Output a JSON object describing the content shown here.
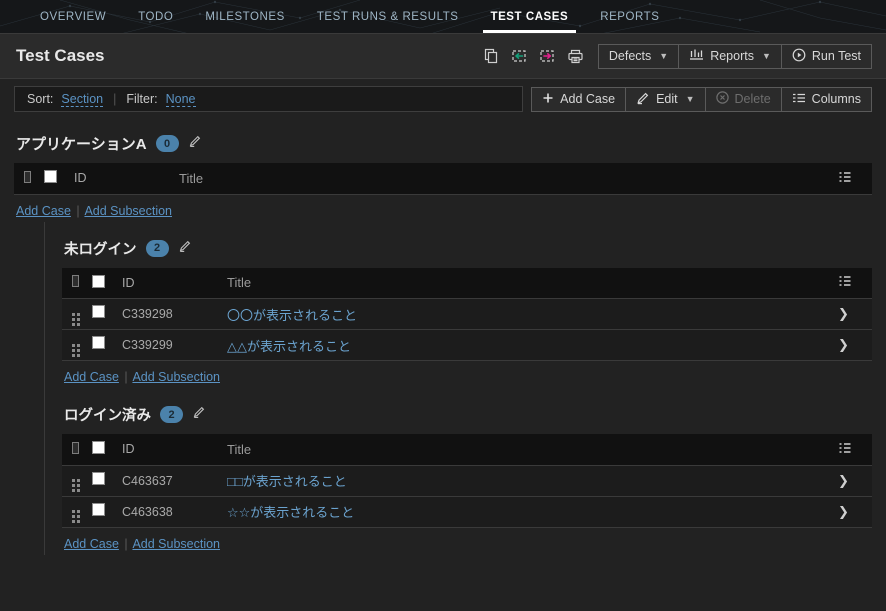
{
  "nav": {
    "items": [
      {
        "label": "OVERVIEW",
        "active": false
      },
      {
        "label": "TODO",
        "active": false
      },
      {
        "label": "MILESTONES",
        "active": false
      },
      {
        "label": "TEST RUNS & RESULTS",
        "active": false
      },
      {
        "label": "TEST CASES",
        "active": true
      },
      {
        "label": "REPORTS",
        "active": false
      }
    ]
  },
  "header": {
    "title": "Test Cases",
    "icons": [
      {
        "name": "copy-icon"
      },
      {
        "name": "import-cases-icon"
      },
      {
        "name": "export-cases-icon"
      },
      {
        "name": "print-icon"
      }
    ],
    "defects_label": "Defects",
    "reports_label": "Reports",
    "run_test_label": "Run Test"
  },
  "subbar": {
    "sort_label": "Sort:",
    "sort_value": "Section",
    "filter_label": "Filter:",
    "filter_value": "None",
    "add_case_label": "Add Case",
    "edit_label": "Edit",
    "delete_label": "Delete",
    "columns_label": "Columns"
  },
  "table_headers": {
    "id": "ID",
    "title": "Title"
  },
  "links": {
    "add_case": "Add Case",
    "add_subsection": "Add Subsection",
    "separator": "|"
  },
  "sections": [
    {
      "title": "アプリケーションA",
      "count": "0",
      "rows": []
    },
    {
      "title": "未ログイン",
      "count": "2",
      "rows": [
        {
          "id": "C339298",
          "title": "〇〇が表示されること"
        },
        {
          "id": "C339299",
          "title": "△△が表示されること"
        }
      ]
    },
    {
      "title": "ログイン済み",
      "count": "2",
      "rows": [
        {
          "id": "C463637",
          "title": "□□が表示されること"
        },
        {
          "id": "C463638",
          "title": "☆☆が表示されること"
        }
      ]
    }
  ],
  "colors": {
    "accent_link": "#5b93c4",
    "badge": "#4b82ab",
    "import_arrow": "#14a07a",
    "export_arrow": "#e0218a",
    "nav_inactive": "#9fb6c6"
  }
}
